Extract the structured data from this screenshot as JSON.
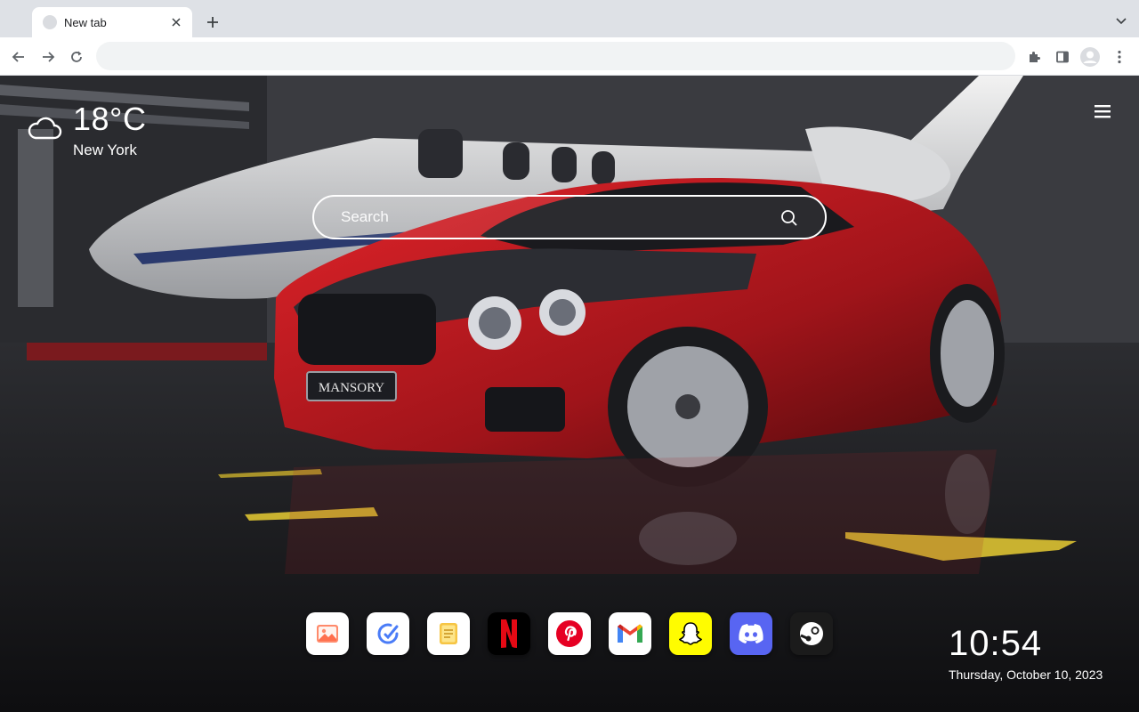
{
  "browser": {
    "tab": {
      "title": "New tab"
    },
    "address_bar": {
      "value": "",
      "placeholder": ""
    }
  },
  "weather": {
    "temperature": "18°C",
    "city": "New York",
    "icon": "cloud-icon"
  },
  "search": {
    "placeholder": "Search"
  },
  "dock": {
    "apps": [
      {
        "name": "photos",
        "icon": "image-icon",
        "color": "#ffffff"
      },
      {
        "name": "todo",
        "icon": "check-circle-icon",
        "color": "#ffffff"
      },
      {
        "name": "notes",
        "icon": "note-icon",
        "color": "#ffffff"
      },
      {
        "name": "netflix",
        "icon": "netflix-icon",
        "color": "#000000"
      },
      {
        "name": "pinterest",
        "icon": "pinterest-icon",
        "color": "#ffffff"
      },
      {
        "name": "gmail",
        "icon": "gmail-icon",
        "color": "#ffffff"
      },
      {
        "name": "snapchat",
        "icon": "snapchat-icon",
        "color": "#fffc00"
      },
      {
        "name": "discord",
        "icon": "discord-icon",
        "color": "#5865f2"
      },
      {
        "name": "steam",
        "icon": "steam-icon",
        "color": "#1b1b1b"
      }
    ]
  },
  "clock": {
    "time": "10:54",
    "date": "Thursday, October 10, 2023"
  },
  "wallpaper": {
    "plate_text": "MANSORY"
  }
}
